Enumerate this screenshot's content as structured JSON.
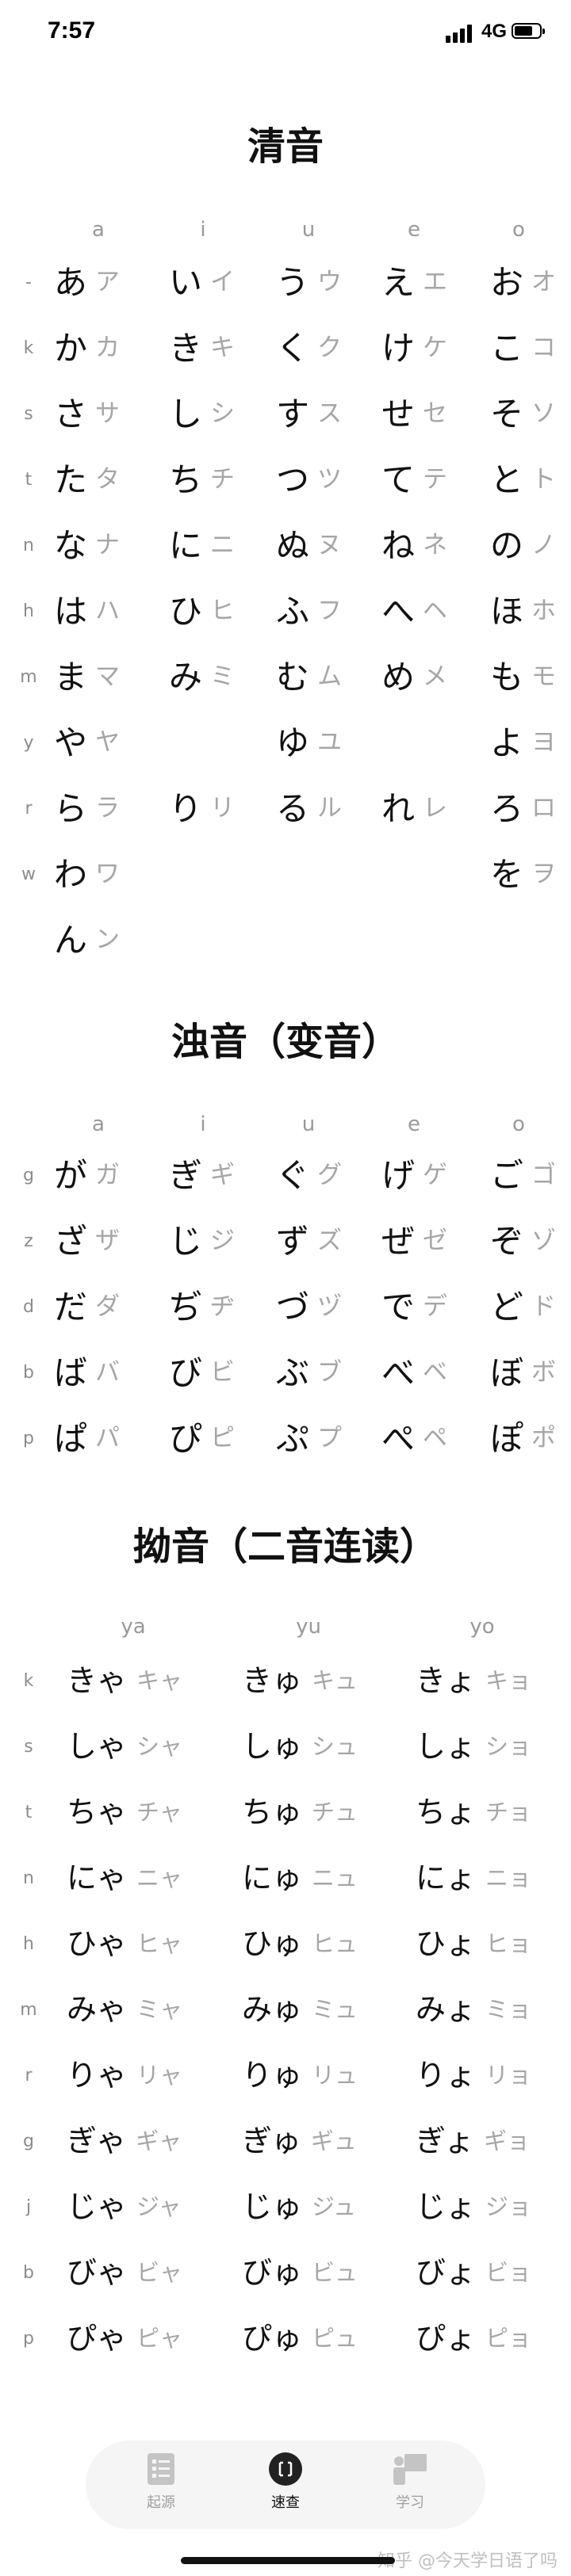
{
  "status_bar": {
    "time": "7:57",
    "network": "4G"
  },
  "sections": [
    {
      "title": "清音",
      "vowels": [
        "a",
        "i",
        "u",
        "e",
        "o"
      ],
      "rows": [
        {
          "label": "-",
          "cells": [
            [
              "あ",
              "ア"
            ],
            [
              "い",
              "イ"
            ],
            [
              "う",
              "ウ"
            ],
            [
              "え",
              "エ"
            ],
            [
              "お",
              "オ"
            ]
          ]
        },
        {
          "label": "k",
          "cells": [
            [
              "か",
              "カ"
            ],
            [
              "き",
              "キ"
            ],
            [
              "く",
              "ク"
            ],
            [
              "け",
              "ケ"
            ],
            [
              "こ",
              "コ"
            ]
          ]
        },
        {
          "label": "s",
          "cells": [
            [
              "さ",
              "サ"
            ],
            [
              "し",
              "シ"
            ],
            [
              "す",
              "ス"
            ],
            [
              "せ",
              "セ"
            ],
            [
              "そ",
              "ソ"
            ]
          ]
        },
        {
          "label": "t",
          "cells": [
            [
              "た",
              "タ"
            ],
            [
              "ち",
              "チ"
            ],
            [
              "つ",
              "ツ"
            ],
            [
              "て",
              "テ"
            ],
            [
              "と",
              "ト"
            ]
          ]
        },
        {
          "label": "n",
          "cells": [
            [
              "な",
              "ナ"
            ],
            [
              "に",
              "ニ"
            ],
            [
              "ぬ",
              "ヌ"
            ],
            [
              "ね",
              "ネ"
            ],
            [
              "の",
              "ノ"
            ]
          ]
        },
        {
          "label": "h",
          "cells": [
            [
              "は",
              "ハ"
            ],
            [
              "ひ",
              "ヒ"
            ],
            [
              "ふ",
              "フ"
            ],
            [
              "へ",
              "ヘ"
            ],
            [
              "ほ",
              "ホ"
            ]
          ]
        },
        {
          "label": "m",
          "cells": [
            [
              "ま",
              "マ"
            ],
            [
              "み",
              "ミ"
            ],
            [
              "む",
              "ム"
            ],
            [
              "め",
              "メ"
            ],
            [
              "も",
              "モ"
            ]
          ]
        },
        {
          "label": "y",
          "cells": [
            [
              "や",
              "ヤ"
            ],
            null,
            [
              "ゆ",
              "ユ"
            ],
            null,
            [
              "よ",
              "ヨ"
            ]
          ]
        },
        {
          "label": "r",
          "cells": [
            [
              "ら",
              "ラ"
            ],
            [
              "り",
              "リ"
            ],
            [
              "る",
              "ル"
            ],
            [
              "れ",
              "レ"
            ],
            [
              "ろ",
              "ロ"
            ]
          ]
        },
        {
          "label": "w",
          "cells": [
            [
              "わ",
              "ワ"
            ],
            null,
            null,
            null,
            [
              "を",
              "ヲ"
            ]
          ]
        },
        {
          "label": "",
          "cells": [
            [
              "ん",
              "ン"
            ],
            null,
            null,
            null,
            null
          ]
        }
      ]
    },
    {
      "title": "浊音（变音）",
      "vowels": [
        "a",
        "i",
        "u",
        "e",
        "o"
      ],
      "rows": [
        {
          "label": "g",
          "cells": [
            [
              "が",
              "ガ"
            ],
            [
              "ぎ",
              "ギ"
            ],
            [
              "ぐ",
              "グ"
            ],
            [
              "げ",
              "ゲ"
            ],
            [
              "ご",
              "ゴ"
            ]
          ]
        },
        {
          "label": "z",
          "cells": [
            [
              "ざ",
              "ザ"
            ],
            [
              "じ",
              "ジ"
            ],
            [
              "ず",
              "ズ"
            ],
            [
              "ぜ",
              "ゼ"
            ],
            [
              "ぞ",
              "ゾ"
            ]
          ]
        },
        {
          "label": "d",
          "cells": [
            [
              "だ",
              "ダ"
            ],
            [
              "ぢ",
              "ヂ"
            ],
            [
              "づ",
              "ヅ"
            ],
            [
              "で",
              "デ"
            ],
            [
              "ど",
              "ド"
            ]
          ]
        },
        {
          "label": "b",
          "cells": [
            [
              "ば",
              "バ"
            ],
            [
              "び",
              "ビ"
            ],
            [
              "ぶ",
              "ブ"
            ],
            [
              "べ",
              "ベ"
            ],
            [
              "ぼ",
              "ボ"
            ]
          ]
        },
        {
          "label": "p",
          "cells": [
            [
              "ぱ",
              "パ"
            ],
            [
              "ぴ",
              "ピ"
            ],
            [
              "ぷ",
              "プ"
            ],
            [
              "ぺ",
              "ペ"
            ],
            [
              "ぽ",
              "ポ"
            ]
          ]
        }
      ]
    },
    {
      "title": "拗音（二音连读）",
      "vowels": [
        "ya",
        "yu",
        "yo"
      ],
      "rows": [
        {
          "label": "k",
          "cells": [
            [
              "きゃ",
              "キャ"
            ],
            [
              "きゅ",
              "キュ"
            ],
            [
              "きょ",
              "キョ"
            ]
          ]
        },
        {
          "label": "s",
          "cells": [
            [
              "しゃ",
              "シャ"
            ],
            [
              "しゅ",
              "シュ"
            ],
            [
              "しょ",
              "ショ"
            ]
          ]
        },
        {
          "label": "t",
          "cells": [
            [
              "ちゃ",
              "チャ"
            ],
            [
              "ちゅ",
              "チュ"
            ],
            [
              "ちょ",
              "チョ"
            ]
          ]
        },
        {
          "label": "n",
          "cells": [
            [
              "にゃ",
              "ニャ"
            ],
            [
              "にゅ",
              "ニュ"
            ],
            [
              "にょ",
              "ニョ"
            ]
          ]
        },
        {
          "label": "h",
          "cells": [
            [
              "ひゃ",
              "ヒャ"
            ],
            [
              "ひゅ",
              "ヒュ"
            ],
            [
              "ひょ",
              "ヒョ"
            ]
          ]
        },
        {
          "label": "m",
          "cells": [
            [
              "みゃ",
              "ミャ"
            ],
            [
              "みゅ",
              "ミュ"
            ],
            [
              "みょ",
              "ミョ"
            ]
          ]
        },
        {
          "label": "r",
          "cells": [
            [
              "りゃ",
              "リャ"
            ],
            [
              "りゅ",
              "リュ"
            ],
            [
              "りょ",
              "リョ"
            ]
          ]
        },
        {
          "label": "g",
          "cells": [
            [
              "ぎゃ",
              "ギャ"
            ],
            [
              "ぎゅ",
              "ギュ"
            ],
            [
              "ぎょ",
              "ギョ"
            ]
          ]
        },
        {
          "label": "j",
          "cells": [
            [
              "じゃ",
              "ジャ"
            ],
            [
              "じゅ",
              "ジュ"
            ],
            [
              "じょ",
              "ジョ"
            ]
          ]
        },
        {
          "label": "b",
          "cells": [
            [
              "びゃ",
              "ビャ"
            ],
            [
              "びゅ",
              "ビュ"
            ],
            [
              "びょ",
              "ビョ"
            ]
          ]
        },
        {
          "label": "p",
          "cells": [
            [
              "ぴゃ",
              "ピャ"
            ],
            [
              "ぴゅ",
              "ピュ"
            ],
            [
              "ぴょ",
              "ピョ"
            ]
          ]
        }
      ]
    }
  ],
  "tab_bar": {
    "tabs": [
      {
        "label": "起源",
        "icon": "document-list-icon",
        "active": false
      },
      {
        "label": "速查",
        "icon": "scan-icon",
        "active": true
      },
      {
        "label": "学习",
        "icon": "teacher-board-icon",
        "active": false
      }
    ]
  },
  "watermark": "知乎 @今天学日语了吗"
}
